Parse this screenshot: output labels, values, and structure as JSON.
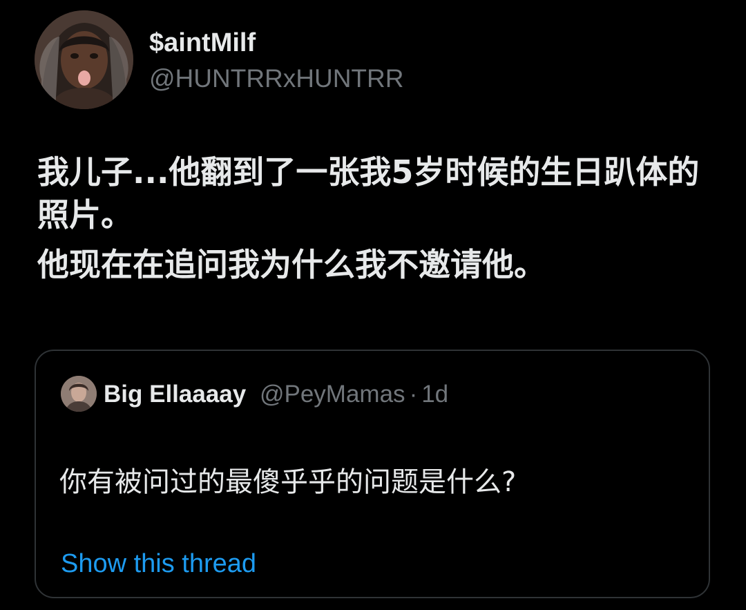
{
  "tweet": {
    "author": {
      "display_name": "$aintMilf",
      "handle": "@HUNTRRxHUNTRR"
    },
    "text_lines": [
      "我儿子...他翻到了一张我5岁时候的生日趴体的照片。",
      "他现在在追问我为什么我不邀请他。"
    ]
  },
  "quoted_tweet": {
    "author": {
      "display_name": "Big Ellaaaay",
      "handle": "@PeyMamas",
      "separator": "·",
      "time": "1d"
    },
    "text": "你有被问过的最傻乎乎的问题是什么?",
    "show_thread_label": "Show this thread"
  },
  "colors": {
    "background": "#000000",
    "primary_text": "#e7e9ea",
    "secondary_text": "#71767b",
    "link": "#1d9bf0",
    "border": "#2f3336"
  }
}
